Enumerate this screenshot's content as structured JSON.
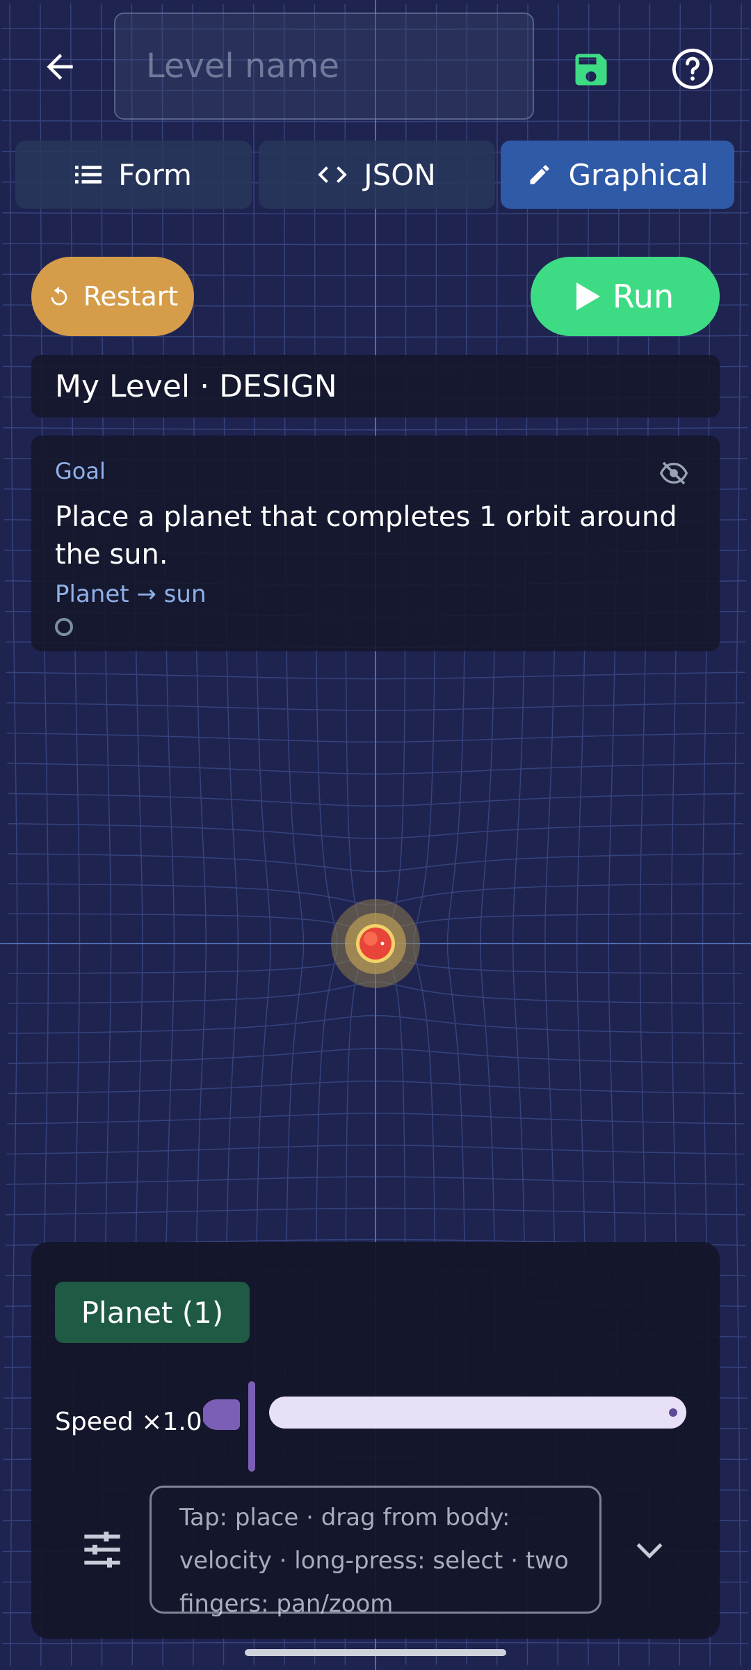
{
  "header": {
    "level_name_placeholder": "Level name",
    "level_name_value": "",
    "back_icon": "arrow-left-icon",
    "save_icon": "floppy-disk-icon",
    "help_icon": "help-circle-icon",
    "save_color": "#3ddc84"
  },
  "tabs": [
    {
      "label": "Form",
      "icon": "list-icon",
      "active": false
    },
    {
      "label": "JSON",
      "icon": "code-icon",
      "active": false
    },
    {
      "label": "Graphical",
      "icon": "pencil-icon",
      "active": true
    }
  ],
  "actions": {
    "restart_label": "Restart",
    "restart_color": "#d59d4a",
    "run_label": "Run",
    "run_color": "#3ddc84"
  },
  "level": {
    "title": "My Level · DESIGN"
  },
  "goal": {
    "label": "Goal",
    "text": "Place a planet that completes 1 orbit around the sun.",
    "hint": "Planet → sun",
    "hide_icon": "eye-off-icon"
  },
  "canvas": {
    "center_body": "sun-icon"
  },
  "controls": {
    "body_chip_label": "Planet (1)",
    "body_chip_color": "#1e5a44",
    "speed_label": "Speed ×1.0",
    "speed_fraction": 0.0,
    "hint_text": "Tap: place · drag from body: velocity · long-press: select · two fingers: pan/zoom",
    "settings_icon": "tune-icon",
    "expand_icon": "chevron-down-icon"
  }
}
